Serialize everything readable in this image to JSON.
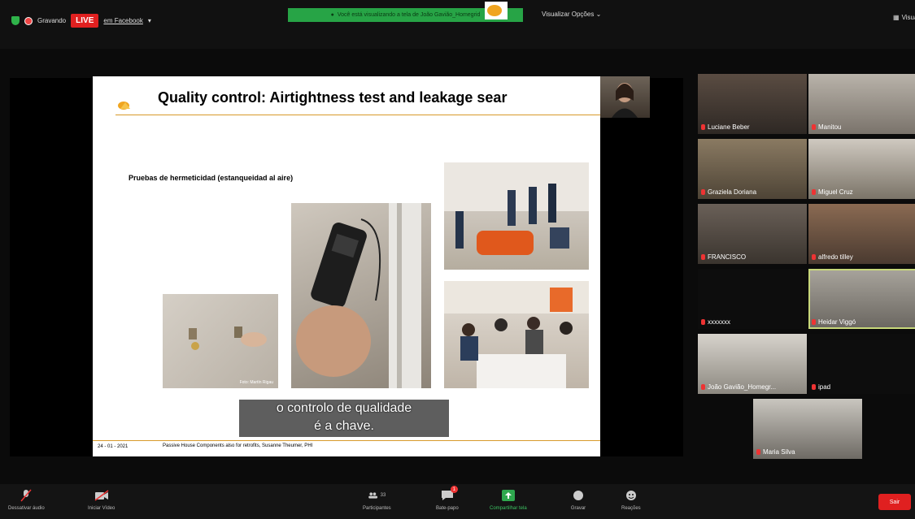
{
  "topbar": {
    "recording_label": "Gravando",
    "live_label": "LIVE",
    "facebook_label": "em Facebook",
    "viewing_banner": "Você está visualizando a tela de João Gavião_Homegrid",
    "view_options": "Visualizar Opções",
    "view_right": "Visualizar"
  },
  "slide": {
    "title": "Quality control: Airtightness test and leakage sear",
    "subtitle": "Pruebas de hermeticidad (estanqueidad al aire)",
    "photo_credit": "Foto: Martín Rigau",
    "footer_date": "24 - 01 - 2021",
    "footer_text": "Passive House Components also for retrofits, Susanne Theumer, PHI"
  },
  "caption": {
    "line1": "o controlo de qualidade",
    "line2": "é a chave."
  },
  "participants": [
    {
      "name": "Luciane Beber"
    },
    {
      "name": "Manitou"
    },
    {
      "name": "Graziela Doriana"
    },
    {
      "name": "Miguel Cruz"
    },
    {
      "name": "FRANCISCO"
    },
    {
      "name": "alfredo tilley"
    },
    {
      "name": "xxxxxxx"
    },
    {
      "name": "Heidar Viggó"
    },
    {
      "name": "João Gavião_Homegr..."
    },
    {
      "name": "ipad"
    },
    {
      "name": "Maria Silva"
    }
  ],
  "toolbar": {
    "mute": "Dessativar áudio",
    "video": "Iniciar Vídeo",
    "participants": "Participantes",
    "participants_count": "33",
    "chat": "Bate-papo",
    "share": "Compartilhar tela",
    "record": "Gravar",
    "reactions": "Reações",
    "leave": "Sair",
    "chat_badge": "1"
  }
}
